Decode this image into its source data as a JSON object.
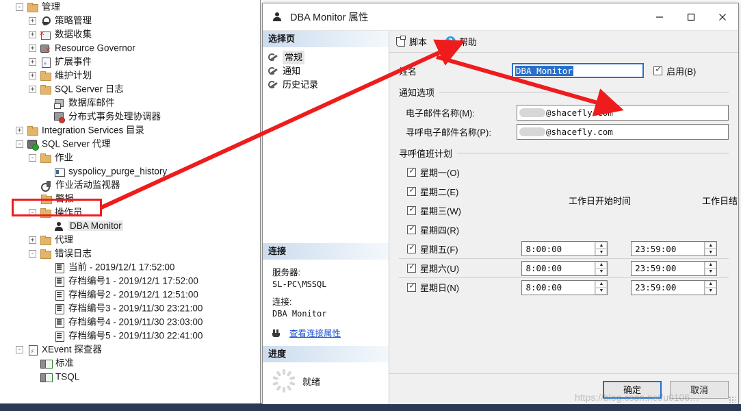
{
  "explorer": {
    "nodes": [
      {
        "label": "管理",
        "indent": 1,
        "expander": "-",
        "icon": "folder"
      },
      {
        "label": "策略管理",
        "indent": 2,
        "expander": "+",
        "icon": "policy"
      },
      {
        "label": "数据收集",
        "indent": 2,
        "expander": "+",
        "icon": "datacol"
      },
      {
        "label": "Resource Governor",
        "indent": 2,
        "expander": "+",
        "icon": "rgov"
      },
      {
        "label": "扩展事件",
        "indent": 2,
        "expander": "+",
        "icon": "xevent"
      },
      {
        "label": "维护计划",
        "indent": 2,
        "expander": "+",
        "icon": "folder"
      },
      {
        "label": "SQL Server 日志",
        "indent": 2,
        "expander": "+",
        "icon": "folder"
      },
      {
        "label": "数据库邮件",
        "indent": 3,
        "expander": "",
        "icon": "mail"
      },
      {
        "label": "分布式事务处理协调器",
        "indent": 3,
        "expander": "",
        "icon": "dtc"
      },
      {
        "label": "Integration Services 目录",
        "indent": 1,
        "expander": "+",
        "icon": "folder"
      },
      {
        "label": "SQL Server 代理",
        "indent": 1,
        "expander": "-",
        "icon": "agent"
      },
      {
        "label": "作业",
        "indent": 2,
        "expander": "-",
        "icon": "folder"
      },
      {
        "label": "syspolicy_purge_history",
        "indent": 3,
        "expander": "",
        "icon": "job"
      },
      {
        "label": "作业活动监视器",
        "indent": 2,
        "expander": "",
        "icon": "jobmon"
      },
      {
        "label": "警报",
        "indent": 2,
        "expander": "",
        "icon": "folder"
      },
      {
        "label": "操作员",
        "indent": 2,
        "expander": "-",
        "icon": "folder"
      },
      {
        "label": "DBA Monitor",
        "indent": 3,
        "expander": "",
        "icon": "person",
        "selected": true
      },
      {
        "label": "代理",
        "indent": 2,
        "expander": "+",
        "icon": "folder"
      },
      {
        "label": "错误日志",
        "indent": 2,
        "expander": "-",
        "icon": "folder"
      },
      {
        "label": "当前 - 2019/12/1 17:52:00",
        "indent": 3,
        "expander": "",
        "icon": "log"
      },
      {
        "label": "存档编号1 - 2019/12/1 17:52:00",
        "indent": 3,
        "expander": "",
        "icon": "log"
      },
      {
        "label": "存档编号2 - 2019/12/1 12:51:00",
        "indent": 3,
        "expander": "",
        "icon": "log"
      },
      {
        "label": "存档编号3 - 2019/11/30 23:21:00",
        "indent": 3,
        "expander": "",
        "icon": "log"
      },
      {
        "label": "存档编号4 - 2019/11/30 23:03:00",
        "indent": 3,
        "expander": "",
        "icon": "log"
      },
      {
        "label": "存档编号5 - 2019/11/30 22:41:00",
        "indent": 3,
        "expander": "",
        "icon": "log"
      },
      {
        "label": "XEvent 探查器",
        "indent": 1,
        "expander": "-",
        "icon": "xevent"
      },
      {
        "label": "标准",
        "indent": 2,
        "expander": "",
        "icon": "sess"
      },
      {
        "label": "TSQL",
        "indent": 2,
        "expander": "",
        "icon": "sess"
      }
    ]
  },
  "dialog": {
    "title": "DBA Monitor 属性",
    "title_icon": "operator-person-icon",
    "window_buttons": {
      "minimize": "—",
      "maximize": "☐",
      "close": "✕"
    },
    "nav": {
      "header": "选择页",
      "items": [
        {
          "label": "常规",
          "active": true
        },
        {
          "label": "通知",
          "active": false
        },
        {
          "label": "历史记录",
          "active": false
        }
      ]
    },
    "connection": {
      "header": "连接",
      "server_label": "服务器:",
      "server_value": "SL-PC\\MSSQL",
      "conn_label": "连接:",
      "conn_value": "DBA Monitor",
      "view_props_link": "查看连接属性"
    },
    "progress": {
      "header": "进度",
      "status": "就绪"
    },
    "toolbar": {
      "script_label": "脚本",
      "script_caret": "▼",
      "help_label": "帮助",
      "help_glyph": "?"
    },
    "form": {
      "name_label": "姓名",
      "name_value": "DBA Monitor",
      "enabled_label": "启用(B)",
      "enabled_checked": true,
      "notify_group_label": "通知选项",
      "email_label": "电子邮件名称(M):",
      "email_value": "@shacefly.com",
      "pager_email_label": "寻呼电子邮件名称(P):",
      "pager_email_value": "@shacefly.com",
      "schedule_group_label": "寻呼值班计划",
      "start_col_header": "工作日开始时间",
      "end_col_header": "工作日结束时间",
      "days": [
        {
          "label": "星期一(O)",
          "checked": true,
          "start": "",
          "end": ""
        },
        {
          "label": "星期二(E)",
          "checked": true,
          "start": "",
          "end": ""
        },
        {
          "label": "星期三(W)",
          "checked": true,
          "start": "",
          "end": ""
        },
        {
          "label": "星期四(R)",
          "checked": true,
          "start": "",
          "end": ""
        },
        {
          "label": "星期五(F)",
          "checked": true,
          "start": "8:00:00",
          "end": "23:59:00"
        },
        {
          "label": "星期六(U)",
          "checked": true,
          "start": "8:00:00",
          "end": "23:59:00"
        },
        {
          "label": "星期日(N)",
          "checked": true,
          "start": "8:00:00",
          "end": "23:59:00"
        }
      ]
    },
    "footer": {
      "ok_label": "确定",
      "cancel_label": "取消"
    }
  },
  "watermark": "https://blog.csdn.net/u0106…",
  "colors": {
    "annotation_red": "#ee1c1c",
    "accent_blue": "#2a6fc9",
    "link_blue": "#1a4fd0",
    "help_blue": "#29a3e0",
    "desktop": "#2b3a52"
  }
}
